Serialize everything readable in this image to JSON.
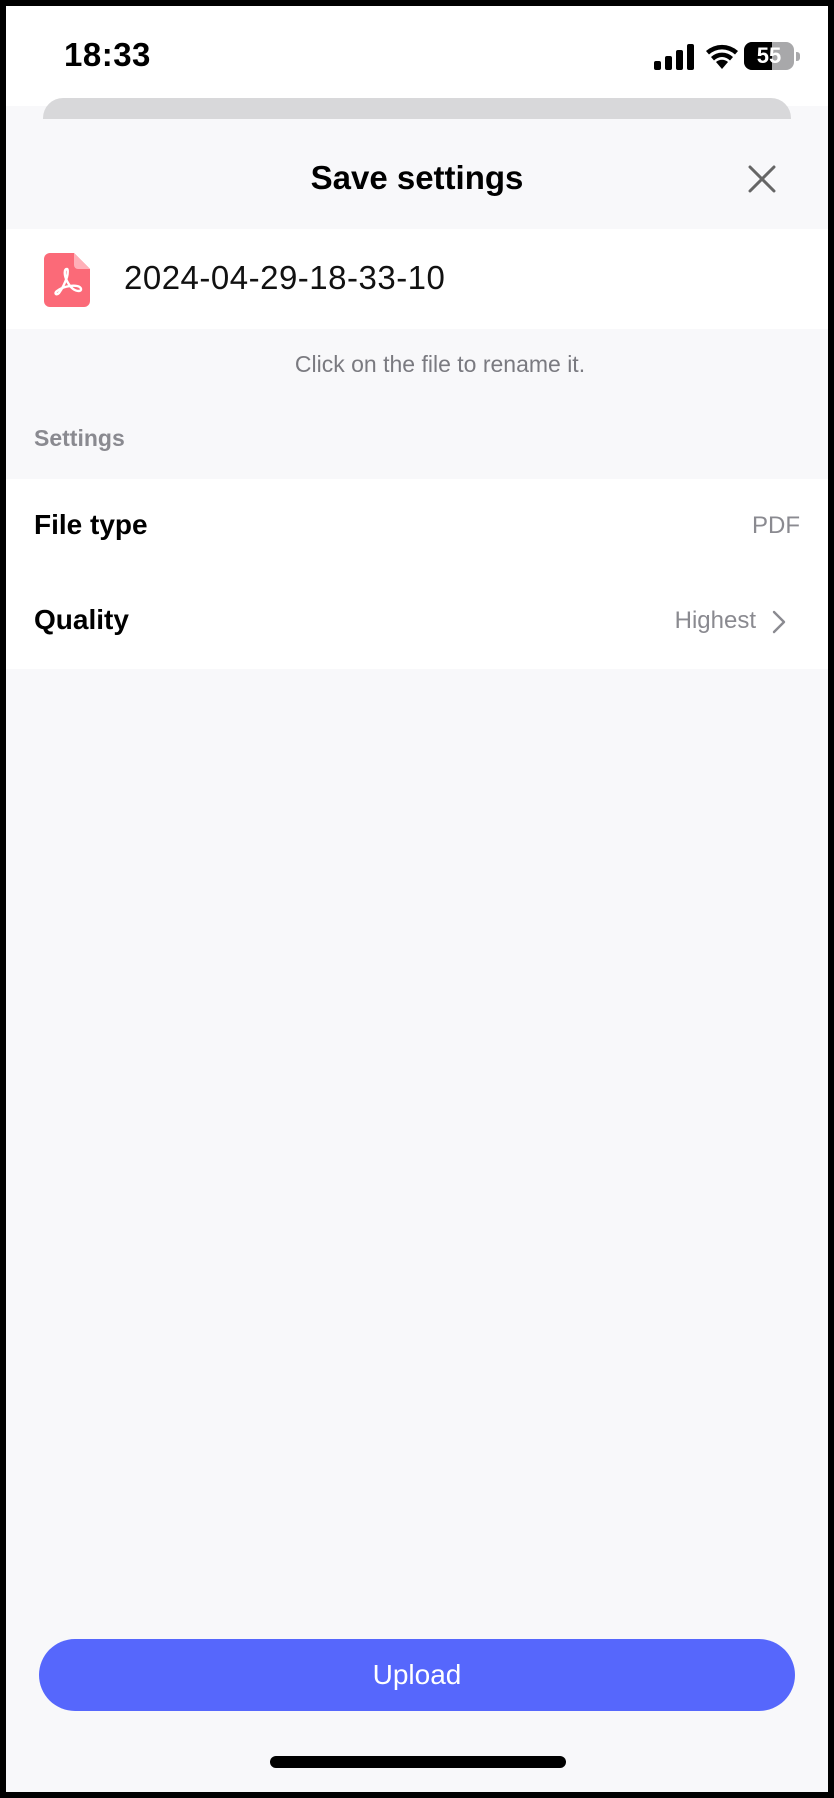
{
  "status_bar": {
    "time": "18:33",
    "battery_level": "55",
    "battery_fraction": 0.55,
    "icons": [
      "signal-icon",
      "wifi-icon",
      "battery-icon"
    ]
  },
  "sheet": {
    "title": "Save settings",
    "close_icon": "close-icon"
  },
  "file": {
    "icon": "pdf-file-icon",
    "name": "2024-04-29-18-33-10",
    "icon_color": "#fb6a78"
  },
  "rename_hint": "Click on the file to rename it.",
  "settings": {
    "section_label": "Settings",
    "rows": [
      {
        "label": "File type",
        "value": "PDF",
        "has_chevron": false
      },
      {
        "label": "Quality",
        "value": "Highest",
        "has_chevron": true
      }
    ]
  },
  "upload_button": {
    "label": "Upload",
    "color": "#5667fc"
  }
}
